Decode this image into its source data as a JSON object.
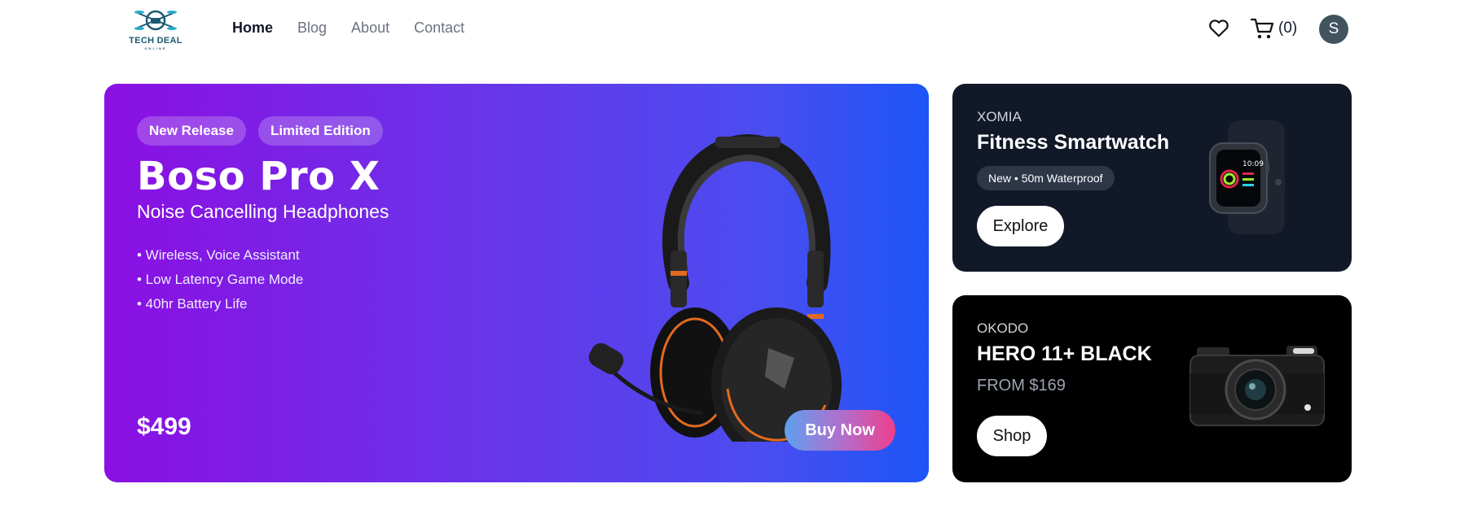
{
  "brand": {
    "logo_text": "TECH DEAL",
    "logo_sub": "ONLINE"
  },
  "nav": {
    "items": [
      {
        "label": "Home",
        "active": true
      },
      {
        "label": "Blog",
        "active": false
      },
      {
        "label": "About",
        "active": false
      },
      {
        "label": "Contact",
        "active": false
      }
    ]
  },
  "header": {
    "cart_count": "(0)",
    "avatar_initial": "S",
    "icons": [
      "heart-icon",
      "cart-icon"
    ]
  },
  "hero": {
    "badges": [
      "New Release",
      "Limited Edition"
    ],
    "title": "Boso Pro X",
    "subtitle": "Noise Cancelling Headphones",
    "features": [
      "• Wireless, Voice Assistant",
      "• Low Latency Game Mode",
      "• 40hr Battery Life"
    ],
    "price": "$499",
    "cta": "Buy Now"
  },
  "cards": [
    {
      "brand": "XOMIA",
      "title": "Fitness Smartwatch",
      "tag": "New • 50m Waterproof",
      "cta": "Explore",
      "watch_time": "10:09"
    },
    {
      "brand": "OKODO",
      "title": "HERO 11+ BLACK",
      "from": "FROM $169",
      "cta": "Shop"
    }
  ],
  "colors": {
    "hero_gradient_start": "#8b0fe3",
    "hero_gradient_end": "#1d55f7",
    "card_dark": "#111827",
    "card_black": "#000000",
    "avatar": "#41545e"
  }
}
